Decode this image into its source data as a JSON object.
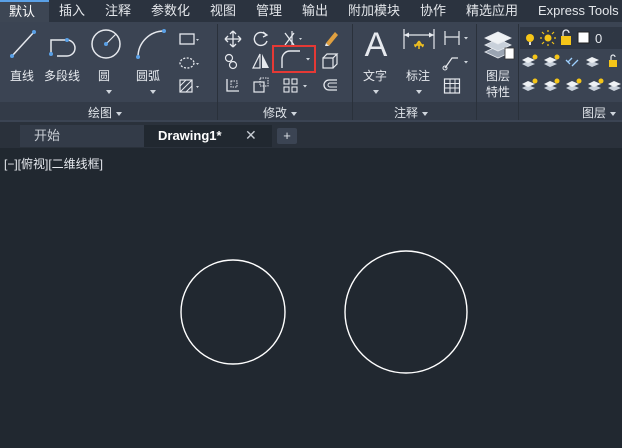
{
  "menu": {
    "tabs": [
      {
        "label": "默认",
        "active": true
      },
      {
        "label": "插入"
      },
      {
        "label": "注释"
      },
      {
        "label": "参数化"
      },
      {
        "label": "视图"
      },
      {
        "label": "管理"
      },
      {
        "label": "输出"
      },
      {
        "label": "附加模块"
      },
      {
        "label": "协作"
      },
      {
        "label": "精选应用"
      },
      {
        "label": "Express Tools"
      }
    ]
  },
  "ribbon": {
    "draw": {
      "title": "绘图",
      "line": "直线",
      "polyline": "多段线",
      "circle": "圆",
      "arc": "圆弧"
    },
    "modify": {
      "title": "修改",
      "highlighted_tool": "fillet-icon"
    },
    "annotation": {
      "title": "注释",
      "text": "文字",
      "dimension": "标注"
    },
    "layers": {
      "title": "图层",
      "layer_properties_line1": "图层",
      "layer_properties_line2": "特性",
      "current_layer": "0"
    }
  },
  "doc_tabs": {
    "start": "开始",
    "drawing": "Drawing1*",
    "close_symbol": "✕",
    "new_symbol": "+"
  },
  "viewport": {
    "label": "[−][俯视][二维线框]"
  },
  "colors": {
    "canvas_bg": "#212830",
    "ribbon_bg": "#3b4453",
    "highlight": "#e53935",
    "accent_blue": "#5aa0e6"
  },
  "drawing": {
    "shapes": [
      "circle",
      "circle"
    ]
  }
}
